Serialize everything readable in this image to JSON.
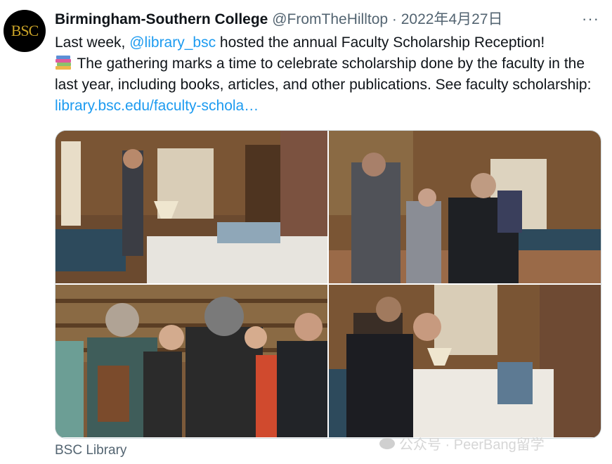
{
  "tweet": {
    "author_name": "Birmingham-Southern College",
    "author_handle": "@FromTheHilltop",
    "separator": "·",
    "date": "2022年4月27日",
    "avatar_text": "BSC",
    "more_label": "···",
    "text": {
      "part1": "Last week, ",
      "mention": "@library_bsc",
      "part2": " hosted the annual Faculty Scholarship Reception!",
      "part3": " The gathering marks a time to celebrate scholarship done by the faculty in the last year, including books, articles, and other publications. See faculty scholarship: ",
      "link": "library.bsc.edu/faculty-schola…"
    },
    "media_caption": "BSC Library"
  },
  "watermark": {
    "text": "公众号 · PeerBang留学"
  },
  "icons": {
    "books": "books-emoji-icon",
    "more": "more-icon"
  },
  "colors": {
    "link": "#1d9bf0",
    "secondary_text": "#536471",
    "primary_text": "#0f1419",
    "avatar_text": "#c9a227"
  }
}
